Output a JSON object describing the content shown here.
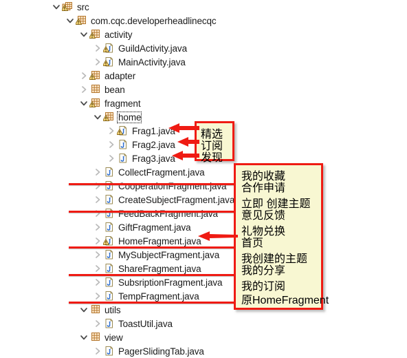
{
  "window": {
    "title": "Package Explorer",
    "background": "#ffffff"
  },
  "colors": {
    "annotation_red": "#ef1b13",
    "callout_fill": "#f8f7d2",
    "text": "#1a1a1a",
    "folder_icon": "#d9a441"
  },
  "tree": {
    "rows": [
      {
        "label": "src",
        "indent": 0,
        "icon": "source-folder-icon",
        "twisty": "expanded",
        "warning": true,
        "selected": false
      },
      {
        "label": "com.cqc.developerheadlinecqc",
        "indent": 1,
        "icon": "package-icon",
        "twisty": "expanded",
        "warning": true,
        "selected": false
      },
      {
        "label": "activity",
        "indent": 2,
        "icon": "package-icon",
        "twisty": "expanded",
        "warning": true,
        "selected": false
      },
      {
        "label": "GuildActivity.java",
        "indent": 3,
        "icon": "java-file-icon",
        "twisty": "collapsed",
        "warning": true,
        "selected": false
      },
      {
        "label": "MainActivity.java",
        "indent": 3,
        "icon": "java-file-icon",
        "twisty": "collapsed",
        "warning": true,
        "selected": false
      },
      {
        "label": "adapter",
        "indent": 2,
        "icon": "package-icon",
        "twisty": "collapsed",
        "warning": true,
        "selected": false
      },
      {
        "label": "bean",
        "indent": 2,
        "icon": "package-icon",
        "twisty": "collapsed",
        "warning": false,
        "selected": false
      },
      {
        "label": "fragment",
        "indent": 2,
        "icon": "package-icon",
        "twisty": "expanded",
        "warning": true,
        "selected": false
      },
      {
        "label": "home",
        "indent": 3,
        "icon": "package-icon",
        "twisty": "expanded",
        "warning": true,
        "selected": true
      },
      {
        "label": "Frag1.java",
        "indent": 4,
        "icon": "java-file-icon",
        "twisty": "collapsed",
        "warning": true,
        "selected": false
      },
      {
        "label": "Frag2.java",
        "indent": 4,
        "icon": "java-file-icon",
        "twisty": "collapsed",
        "warning": false,
        "selected": false
      },
      {
        "label": "Frag3.java",
        "indent": 4,
        "icon": "java-file-icon",
        "twisty": "collapsed",
        "warning": false,
        "selected": false
      },
      {
        "label": "CollectFragment.java",
        "indent": 3,
        "icon": "java-file-icon",
        "twisty": "collapsed",
        "warning": false,
        "selected": false
      },
      {
        "label": "CooperationFragment.java",
        "indent": 3,
        "icon": "java-file-icon",
        "twisty": "collapsed",
        "warning": false,
        "selected": false
      },
      {
        "label": "CreateSubjectFragment.java",
        "indent": 3,
        "icon": "java-file-icon",
        "twisty": "collapsed",
        "warning": false,
        "selected": false
      },
      {
        "label": "FeedBackFragment.java",
        "indent": 3,
        "icon": "java-file-icon",
        "twisty": "collapsed",
        "warning": false,
        "selected": false
      },
      {
        "label": "GiftFragment.java",
        "indent": 3,
        "icon": "java-file-icon",
        "twisty": "collapsed",
        "warning": false,
        "selected": false
      },
      {
        "label": "HomeFragment.java",
        "indent": 3,
        "icon": "java-file-icon",
        "twisty": "collapsed",
        "warning": true,
        "selected": false
      },
      {
        "label": "MySubjectFragment.java",
        "indent": 3,
        "icon": "java-file-icon",
        "twisty": "collapsed",
        "warning": false,
        "selected": false
      },
      {
        "label": "ShareFragment.java",
        "indent": 3,
        "icon": "java-file-icon",
        "twisty": "collapsed",
        "warning": false,
        "selected": false
      },
      {
        "label": "SubsriptionFragment.java",
        "indent": 3,
        "icon": "java-file-icon",
        "twisty": "collapsed",
        "warning": false,
        "selected": false
      },
      {
        "label": "TempFragment.java",
        "indent": 3,
        "icon": "java-file-icon",
        "twisty": "collapsed",
        "warning": false,
        "selected": false
      },
      {
        "label": "utils",
        "indent": 2,
        "icon": "package-icon",
        "twisty": "expanded",
        "warning": false,
        "selected": false
      },
      {
        "label": "ToastUtil.java",
        "indent": 3,
        "icon": "java-file-icon",
        "twisty": "collapsed",
        "warning": false,
        "selected": false
      },
      {
        "label": "view",
        "indent": 2,
        "icon": "package-icon",
        "twisty": "expanded",
        "warning": false,
        "selected": false
      },
      {
        "label": "PagerSlidingTab.java",
        "indent": 3,
        "icon": "java-file-icon",
        "twisty": "collapsed",
        "warning": false,
        "selected": false
      }
    ]
  },
  "annotations": {
    "callout_top": {
      "lines": [
        "精选",
        "订阅",
        "发现"
      ]
    },
    "callout_main": {
      "groups": [
        {
          "lines": [
            "我的收藏",
            "合作申请"
          ]
        },
        {
          "lines": [
            "立即 创建主题",
            "意见反馈"
          ]
        },
        {
          "lines": [
            "礼物兑换",
            "首页"
          ]
        },
        {
          "lines": [
            "我创建的主题",
            "我的分享"
          ]
        },
        {
          "lines": [
            "我的订阅"
          ]
        },
        {
          "lines": [
            "原HomeFragment"
          ]
        }
      ]
    }
  }
}
